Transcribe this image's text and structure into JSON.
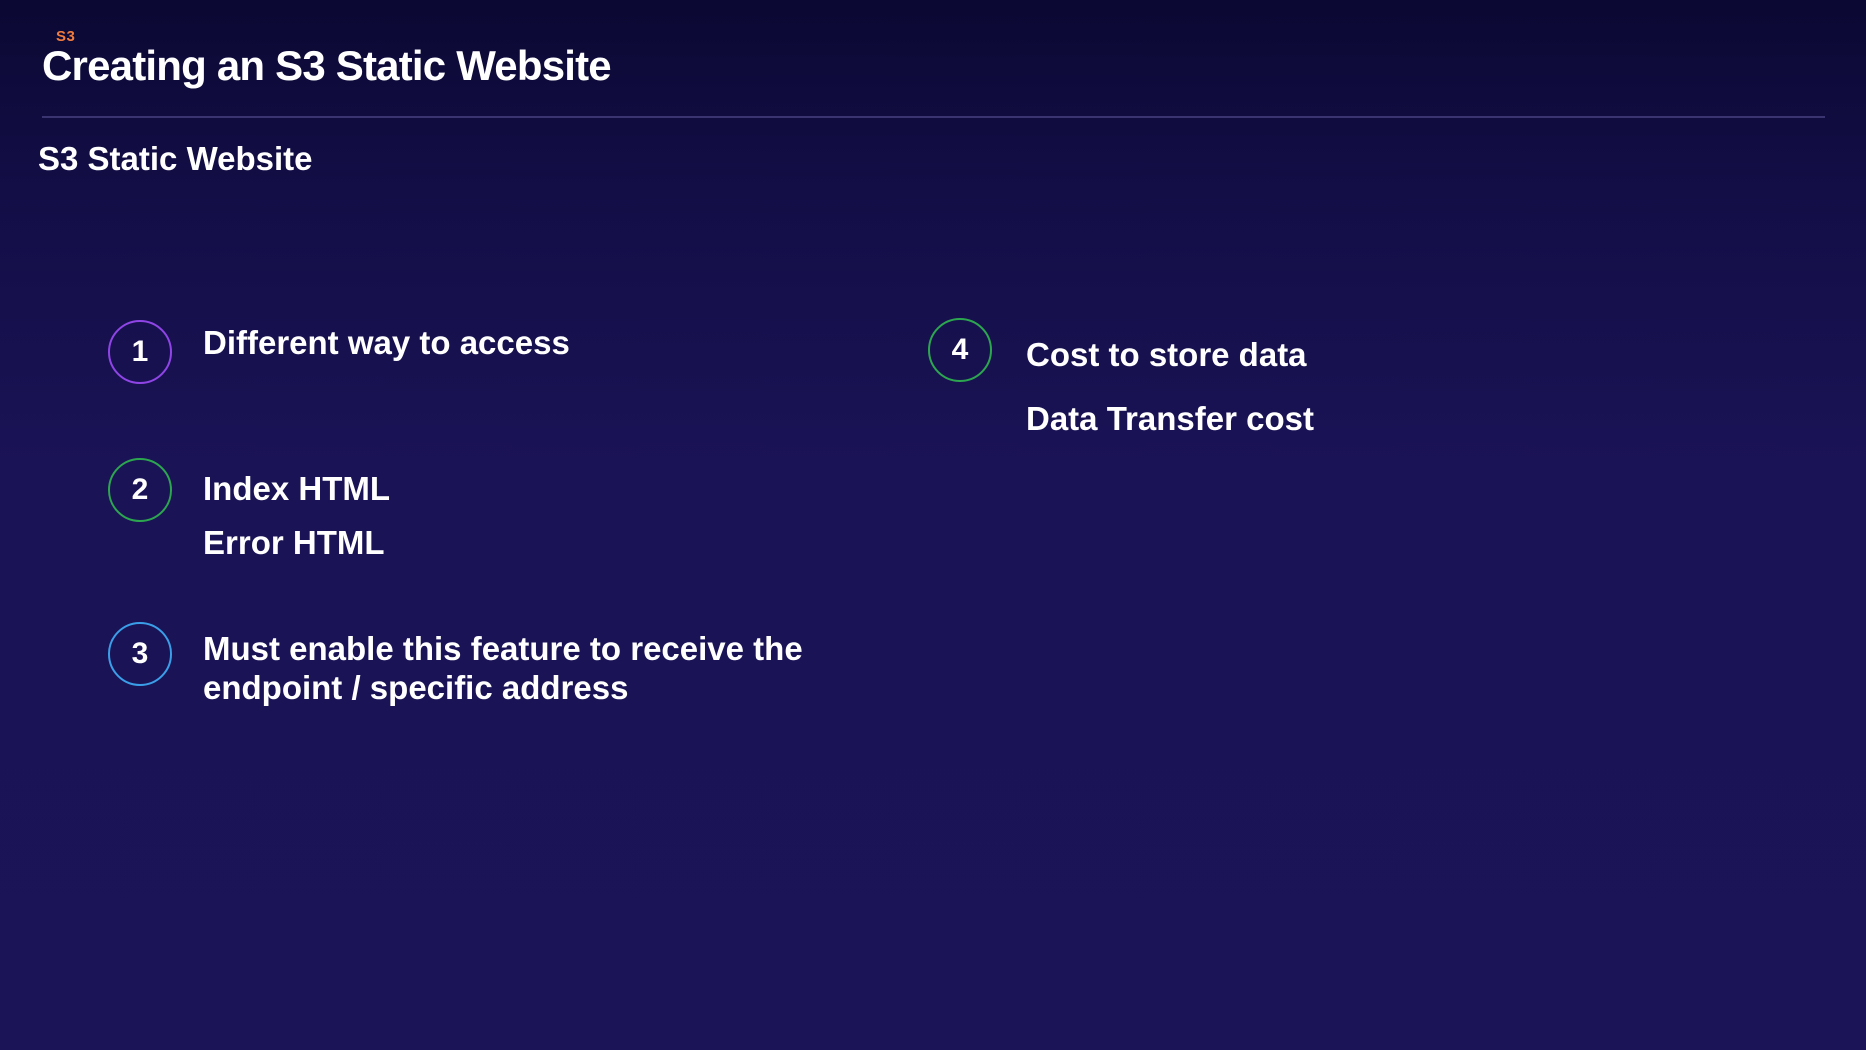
{
  "header": {
    "course_tag": "S3",
    "title": "Creating an S3 Static Website"
  },
  "section_title": "S3 Static Website",
  "items": [
    {
      "number": "1",
      "lines": [
        "Different way to access"
      ]
    },
    {
      "number": "2",
      "lines": [
        "Index HTML",
        "Error HTML"
      ]
    },
    {
      "number": "3",
      "lines": [
        "Must enable this feature to receive the",
        "endpoint / specific address"
      ]
    },
    {
      "number": "4",
      "lines": [
        "Cost to store data",
        "Data Transfer cost"
      ]
    }
  ],
  "colors": {
    "accent_orange": "#f07b3f",
    "badge_purple": "#8f45e6",
    "badge_green": "#2da650",
    "badge_blue": "#3b9ee8",
    "background": "#1b1457"
  }
}
